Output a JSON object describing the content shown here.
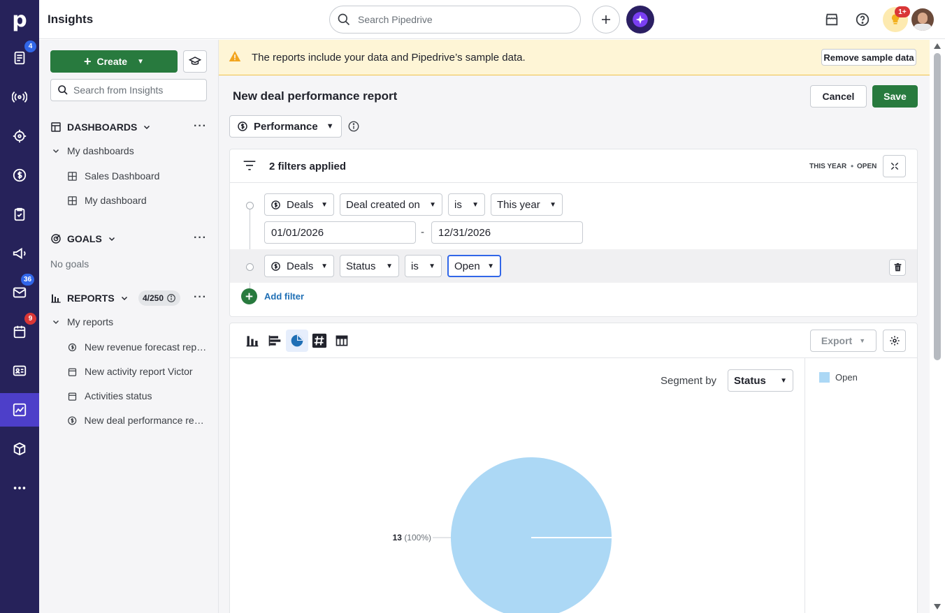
{
  "app": {
    "title": "Insights",
    "logo_letter": "p"
  },
  "rail": {
    "badges": {
      "deals_docs": "4",
      "mail": "36",
      "calendar": "9"
    }
  },
  "topbar": {
    "search_placeholder": "Search Pipedrive",
    "notif_badge": "1+"
  },
  "sidebar": {
    "create_label": "Create",
    "search_placeholder": "Search from Insights",
    "dashboards_label": "DASHBOARDS",
    "my_dashboards_label": "My dashboards",
    "dashboards": [
      {
        "label": "Sales Dashboard"
      },
      {
        "label": "My dashboard"
      }
    ],
    "goals_label": "GOALS",
    "no_goals": "No goals",
    "reports_label": "REPORTS",
    "reports_count": "4/250",
    "my_reports_label": "My reports",
    "reports": [
      {
        "label": "New revenue forecast report",
        "icon": "forecast-icon"
      },
      {
        "label": "New activity report Victor",
        "icon": "calendar-icon"
      },
      {
        "label": "Activities status",
        "icon": "calendar-icon"
      },
      {
        "label": "New deal performance report",
        "icon": "dollar-icon"
      }
    ]
  },
  "banner": {
    "text": "The reports include your data and Pipedrive’s sample data.",
    "remove_label": "Remove sample data"
  },
  "report": {
    "title": "New deal performance report",
    "cancel_label": "Cancel",
    "save_label": "Save",
    "type_label": "Performance"
  },
  "filters": {
    "summary": "2 filters applied",
    "tag_period": "THIS YEAR",
    "tag_status": "OPEN",
    "row1": {
      "entity": "Deals",
      "field": "Deal created on",
      "op": "is",
      "value": "This year",
      "from": "01/01/2026",
      "dash": "-",
      "to": "12/31/2026"
    },
    "row2": {
      "entity": "Deals",
      "field": "Status",
      "op": "is",
      "value": "Open"
    },
    "add_label": "Add filter"
  },
  "chart_controls": {
    "export_label": "Export",
    "segment_by_label": "Segment by",
    "segment_value": "Status"
  },
  "chart_data": {
    "type": "pie",
    "categories": [
      "Open"
    ],
    "values": [
      13
    ],
    "slice_labels": [
      {
        "value": "13",
        "pct": "(100%)"
      }
    ],
    "legend": [
      {
        "name": "Open",
        "color": "#acd8f5"
      }
    ],
    "colors": [
      "#acd8f5"
    ]
  },
  "colors": {
    "brand_green": "#287a3e",
    "rail": "#26225a",
    "accent": "#3166e8"
  }
}
